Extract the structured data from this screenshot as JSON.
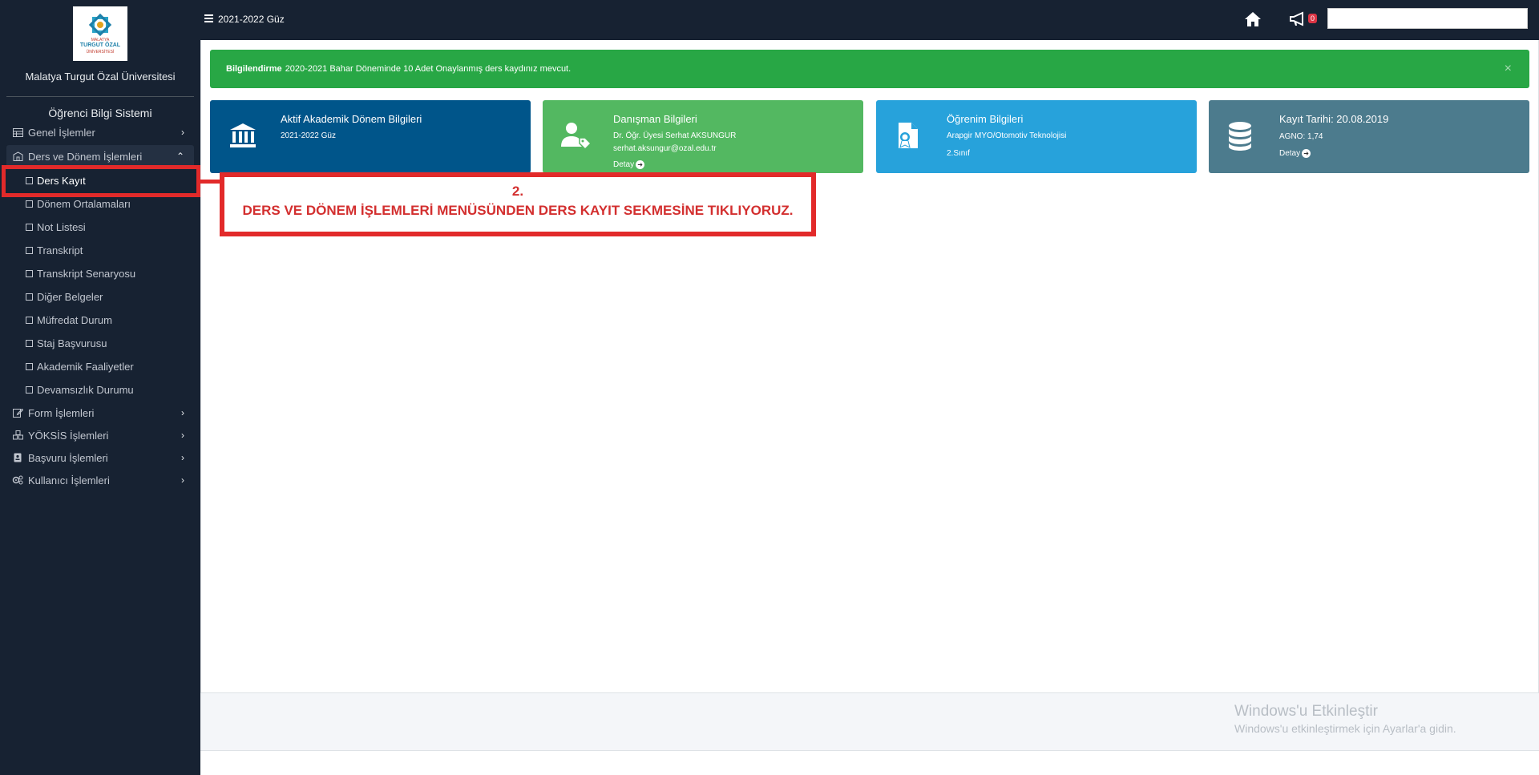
{
  "sidebar": {
    "university_name": "Malatya Turgut Özal Üniversitesi",
    "logo_top": "MALATYA",
    "logo_name": "TURGUT ÖZAL",
    "logo_bottom": "ÜNİVERSİTESİ",
    "system_name": "Öğrenci Bilgi Sistemi",
    "menu": {
      "genel": "Genel İşlemler",
      "ders_donem": "Ders ve Dönem İşlemleri",
      "form": "Form İşlemleri",
      "yoksis": "YÖKSİS İşlemleri",
      "basvuru": "Başvuru İşlemleri",
      "kullanici": "Kullanıcı İşlemleri"
    },
    "submenu": [
      "Ders Kayıt",
      "Dönem Ortalamaları",
      "Not Listesi",
      "Transkript",
      "Transkript Senaryosu",
      "Diğer Belgeler",
      "Müfredat Durum",
      "Staj Başvurusu",
      "Akademik Faaliyetler",
      "Devamsızlık Durumu"
    ]
  },
  "topbar": {
    "term": "2021-2022 Güz",
    "notification_count": "0",
    "search_placeholder": ""
  },
  "alert": {
    "label": "Bilgilendirme",
    "text": "2020-2021 Bahar Döneminde 10 Adet Onaylanmış ders kaydınız mevcut.",
    "close": "×"
  },
  "cards": {
    "academic": {
      "title": "Aktif Akademik Dönem Bilgileri",
      "line1": "2021-2022 Güz"
    },
    "advisor": {
      "title": "Danışman Bilgileri",
      "line1": "Dr. Öğr. Üyesi Serhat AKSUNGUR",
      "line2": "serhat.aksungur@ozal.edu.tr",
      "link": "Detay"
    },
    "education": {
      "title": "Öğrenim Bilgileri",
      "line1": "Arapgir MYO/Otomotiv Teknolojisi",
      "line2": "2.Sınıf"
    },
    "registration": {
      "title": "Kayıt Tarihi: 20.08.2019",
      "line1": "AGNO: 1,74",
      "link": "Detay"
    }
  },
  "annotation": {
    "step": "2.",
    "message": "DERS VE DÖNEM İŞLEMLERİ MENÜSÜNDEN DERS KAYIT SEKMESİNE TIKLIYORUZ."
  },
  "watermark": {
    "title": "Windows'u Etkinleştir",
    "subtitle": "Windows'u etkinleştirmek için Ayarlar'a gidin."
  },
  "colors": {
    "sidebar_bg": "#172232",
    "alert_green": "#28a745",
    "card_blue": "#00558a",
    "card_green": "#53b861",
    "card_lightblue": "#27a2db",
    "card_slate": "#4c7b8d",
    "annotation_red": "#e22a2a"
  },
  "icons": [
    "home-icon",
    "megaphone-icon",
    "bank-icon",
    "user-tag-icon",
    "certificate-icon",
    "database-icon"
  ]
}
